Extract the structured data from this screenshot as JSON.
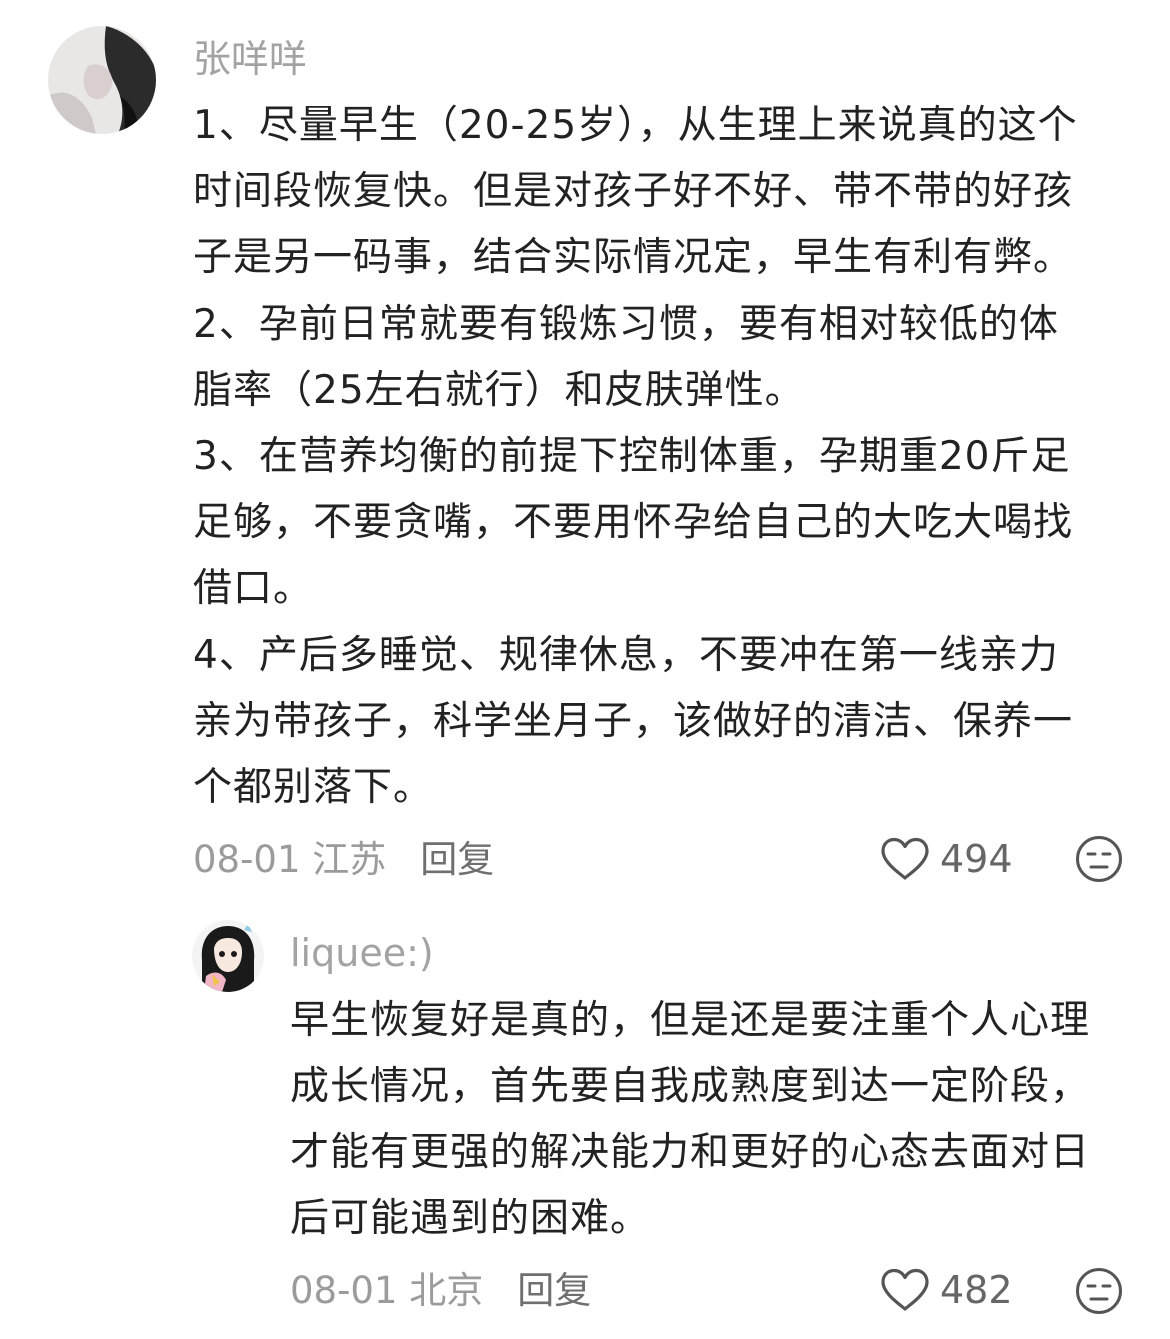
{
  "comments": [
    {
      "username": "张咩咩",
      "text": "1、尽量早生（20-25岁），从生理上来说真的这个\n时间段恢复快。但是对孩子好不好、带不带的好孩\n子是另一码事，结合实际情况定，早生有利有弊。\n2、孕前日常就要有锻炼习惯，要有相对较低的体\n脂率（25左右就行）和皮肤弹性。\n3、在营养均衡的前提下控制体重，孕期重20斤足\n足够，不要贪嘴，不要用怀孕给自己的大吃大喝找\n借口。\n4、产后多睡觉、规律休息，不要冲在第一线亲力\n亲为带孩子，科学坐月子，该做好的清洁、保养一\n个都别落下。",
      "date_location": "08-01 江苏",
      "reply_label": "回复",
      "like_count": "494",
      "avatar_icon": "user-avatar",
      "like_icon": "heart-outline-icon",
      "dislike_icon": "unamused-face-icon"
    },
    {
      "username": "liquee:)",
      "text": "早生恢复好是真的，但是还是要注重个人心理\n成长情况，首先要自我成熟度到达一定阶段，\n才能有更强的解决能力和更好的心态去面对日\n后可能遇到的困难。",
      "date_location": "08-01 北京",
      "reply_label": "回复",
      "like_count": "482",
      "avatar_icon": "user-avatar",
      "like_icon": "heart-outline-icon",
      "dislike_icon": "unamused-face-icon"
    }
  ],
  "colors": {
    "background": "#ffffff",
    "username": "#a3a3a3",
    "body_text": "#222222",
    "meta_text": "#9b9b9b",
    "icon_stroke": "#555555"
  }
}
